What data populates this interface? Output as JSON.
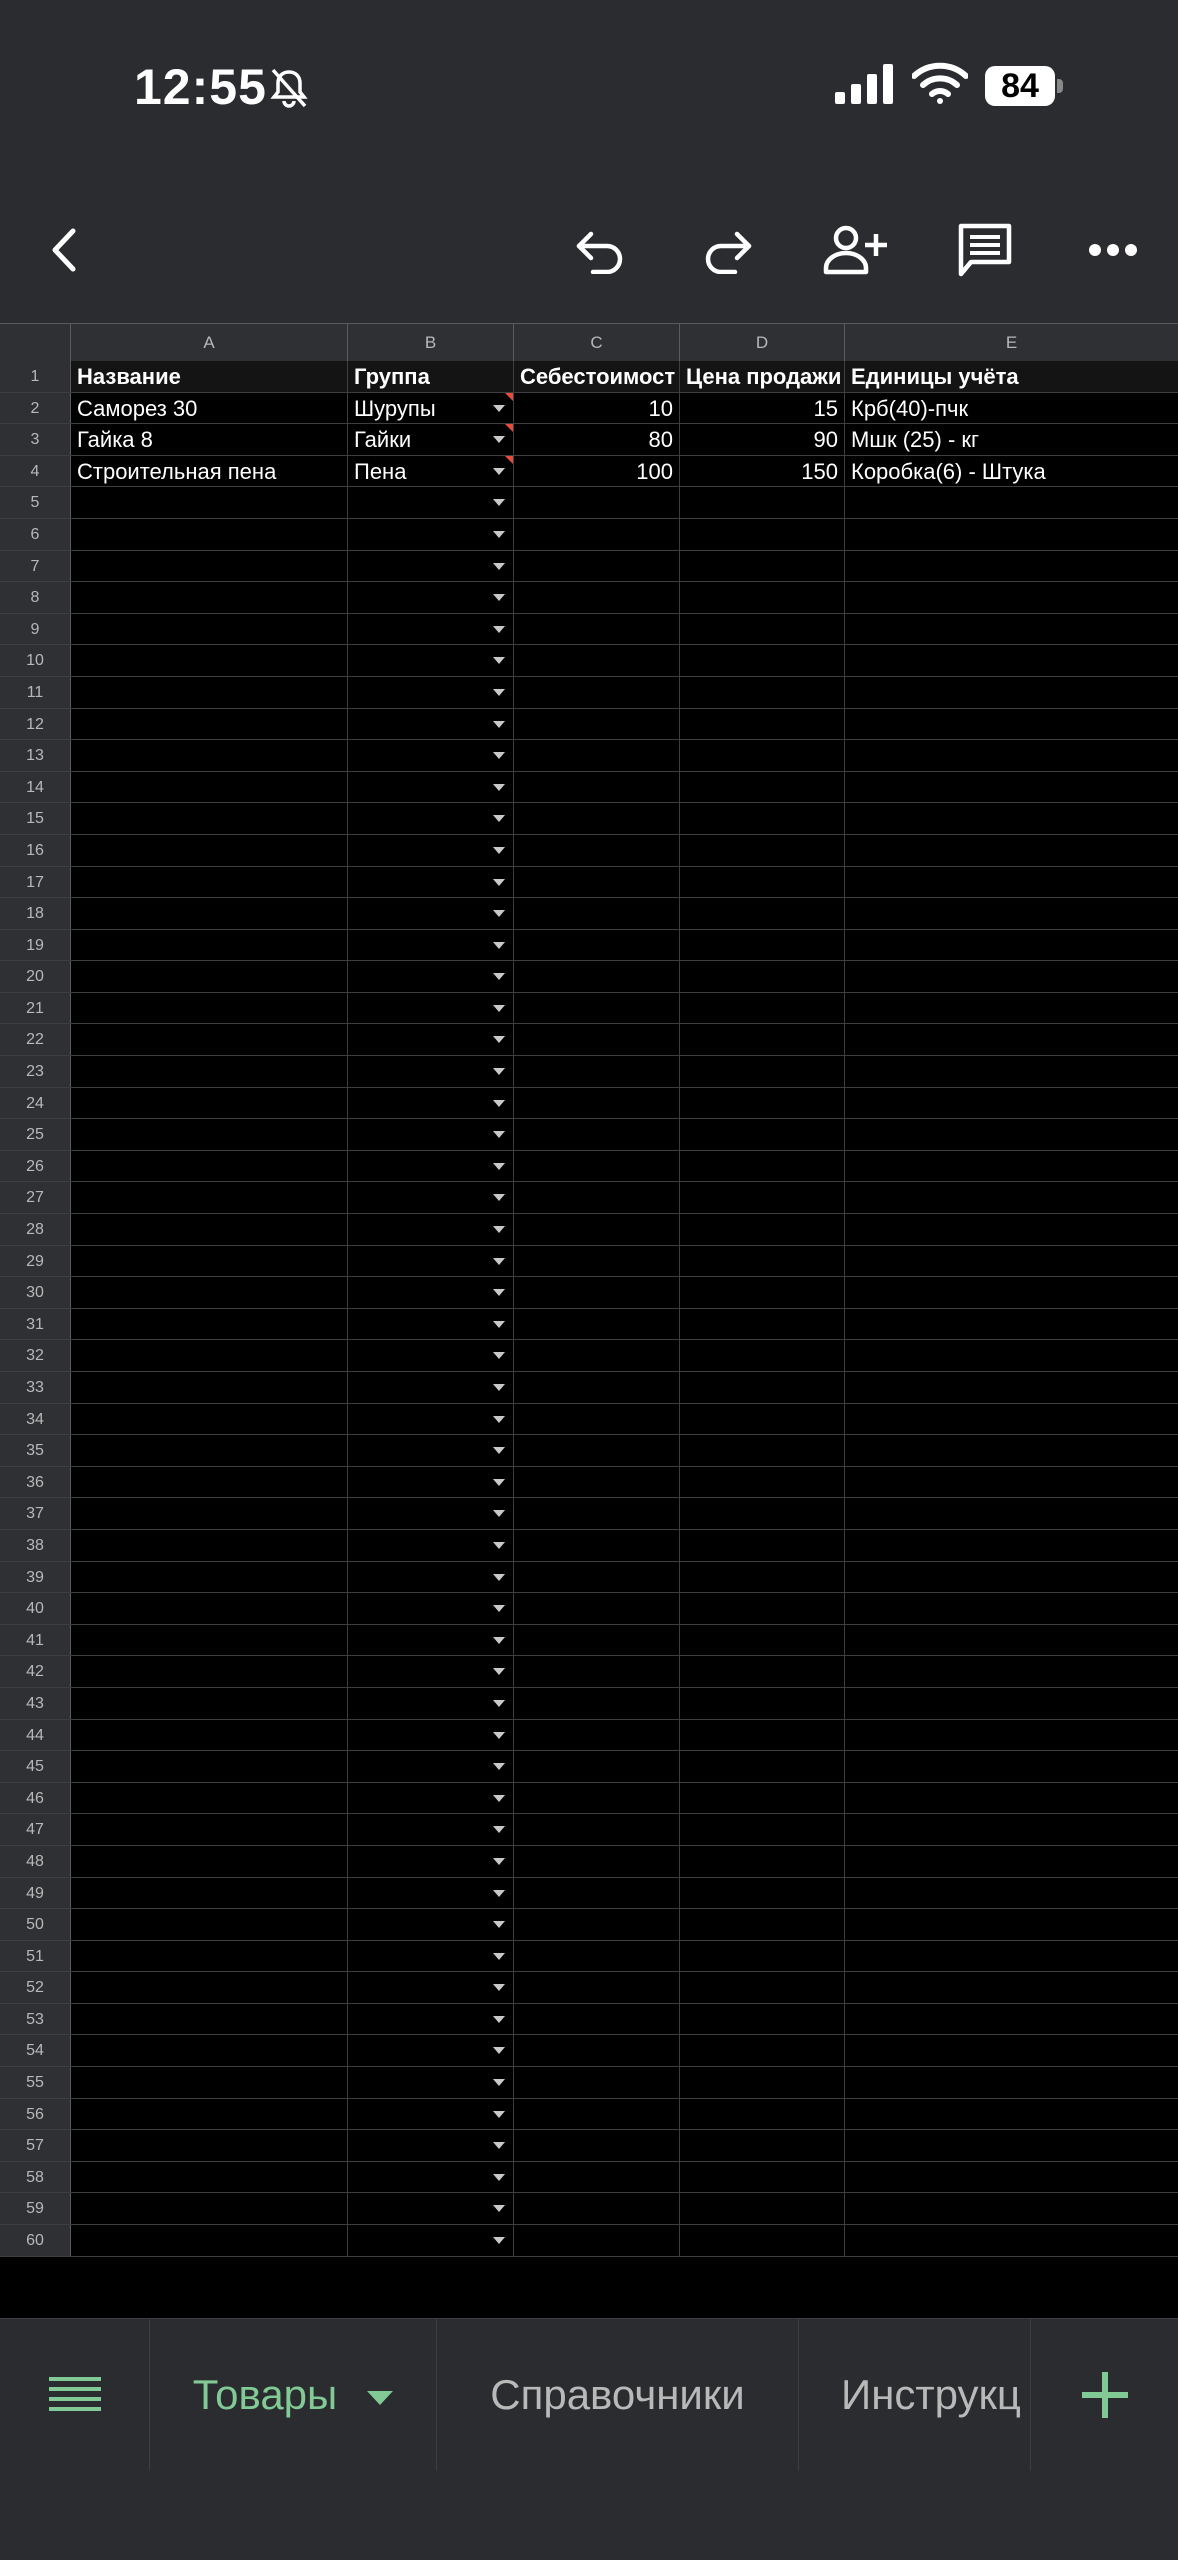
{
  "status": {
    "time": "12:55",
    "battery": "84"
  },
  "toolbar": {
    "back_icon": "chevron-left-icon",
    "undo_icon": "undo-icon",
    "redo_icon": "redo-icon",
    "share_icon": "add-person-icon",
    "comment_icon": "comment-icon",
    "more_icon": "more-horizontal-icon"
  },
  "columns": [
    "A",
    "B",
    "C",
    "D",
    "E"
  ],
  "header_row": {
    "num": "1",
    "A": "Название",
    "B": "Группа",
    "C": "Себестоимост",
    "D": "Цена продажи",
    "E": "Единицы учёта"
  },
  "data_rows": [
    {
      "num": "2",
      "A": "Саморез 30",
      "B": "Шурупы",
      "C": "10",
      "D": "15",
      "E": "Крб(40)-пчк"
    },
    {
      "num": "3",
      "A": "Гайка 8",
      "B": "Гайки",
      "C": "80",
      "D": "90",
      "E": "Мшк (25) - кг"
    },
    {
      "num": "4",
      "A": "Строительная пена",
      "B": "Пена",
      "C": "100",
      "D": "150",
      "E": "Коробка(6) - Штука"
    }
  ],
  "empty_rows": [
    "5",
    "6",
    "7",
    "8",
    "9",
    "10",
    "11",
    "12",
    "13",
    "14",
    "15",
    "16",
    "17",
    "18",
    "19",
    "20",
    "21",
    "22",
    "23",
    "24",
    "25",
    "26",
    "27",
    "28",
    "29",
    "30",
    "31",
    "32",
    "33",
    "34",
    "35",
    "36",
    "37",
    "38",
    "39",
    "40",
    "41",
    "42",
    "43",
    "44",
    "45",
    "46",
    "47",
    "48",
    "49",
    "50",
    "51",
    "52",
    "53",
    "54",
    "55",
    "56",
    "57",
    "58",
    "59",
    "60"
  ],
  "sheets": {
    "active": "Товары",
    "tab2": "Справочники",
    "tab3": "Инструкц"
  },
  "colors": {
    "accent": "#81c995",
    "flag": "#e54c3c"
  }
}
